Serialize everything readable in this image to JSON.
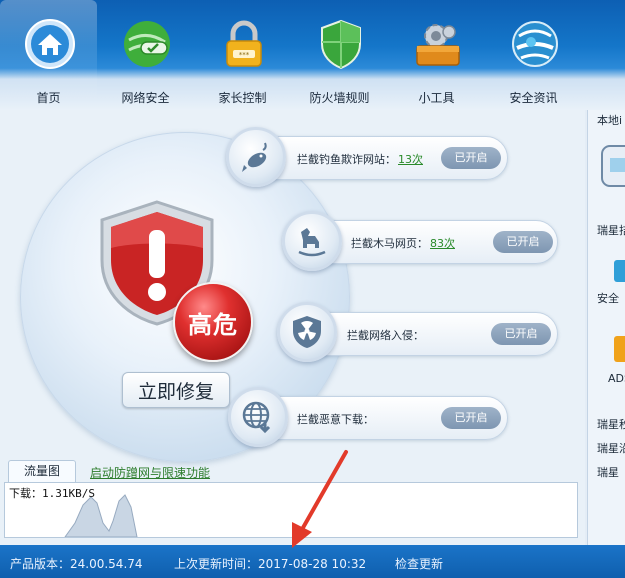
{
  "nav": [
    {
      "label": "首页",
      "icon": "home-icon"
    },
    {
      "label": "网络安全",
      "icon": "network-security-icon"
    },
    {
      "label": "家长控制",
      "icon": "padlock-icon"
    },
    {
      "label": "防火墙规则",
      "icon": "firewall-shield-icon"
    },
    {
      "label": "小工具",
      "icon": "toolbox-icon"
    },
    {
      "label": "安全资讯",
      "icon": "globe-icon"
    }
  ],
  "status": {
    "level": "高危",
    "fix_label": "立即修复"
  },
  "features": [
    {
      "label": "拦截钓鱼欺诈网站：",
      "count": "13次",
      "state": "已开启",
      "icon": "fish-icon"
    },
    {
      "label": "拦截木马网页：",
      "count": "83次",
      "state": "已开启",
      "icon": "trojan-horse-icon"
    },
    {
      "label": "拦截网络入侵：",
      "count": "",
      "state": "已开启",
      "icon": "radiation-shield-icon"
    },
    {
      "label": "拦截恶意下载：",
      "count": "",
      "state": "已开启",
      "icon": "globe-download-icon"
    }
  ],
  "traffic": {
    "tab_label": "流量图",
    "link_label": "启动防蹭网与限速功能",
    "download_label": "下载：1.31KB/S"
  },
  "side_panel": {
    "items": [
      "本地i",
      "瑞星拮",
      "安全",
      "ADS",
      "瑞星秒",
      "瑞星沿",
      "瑞星"
    ]
  },
  "status_bar": {
    "version": "产品版本：24.00.54.74",
    "last_update": "上次更新时间：2017-08-28 10:32",
    "check_update": "检查更新"
  },
  "colors": {
    "accent": "#1476c9",
    "danger": "#e0302f",
    "link_green": "#2d7d2d",
    "annotation_arrow": "#e23a2a"
  }
}
